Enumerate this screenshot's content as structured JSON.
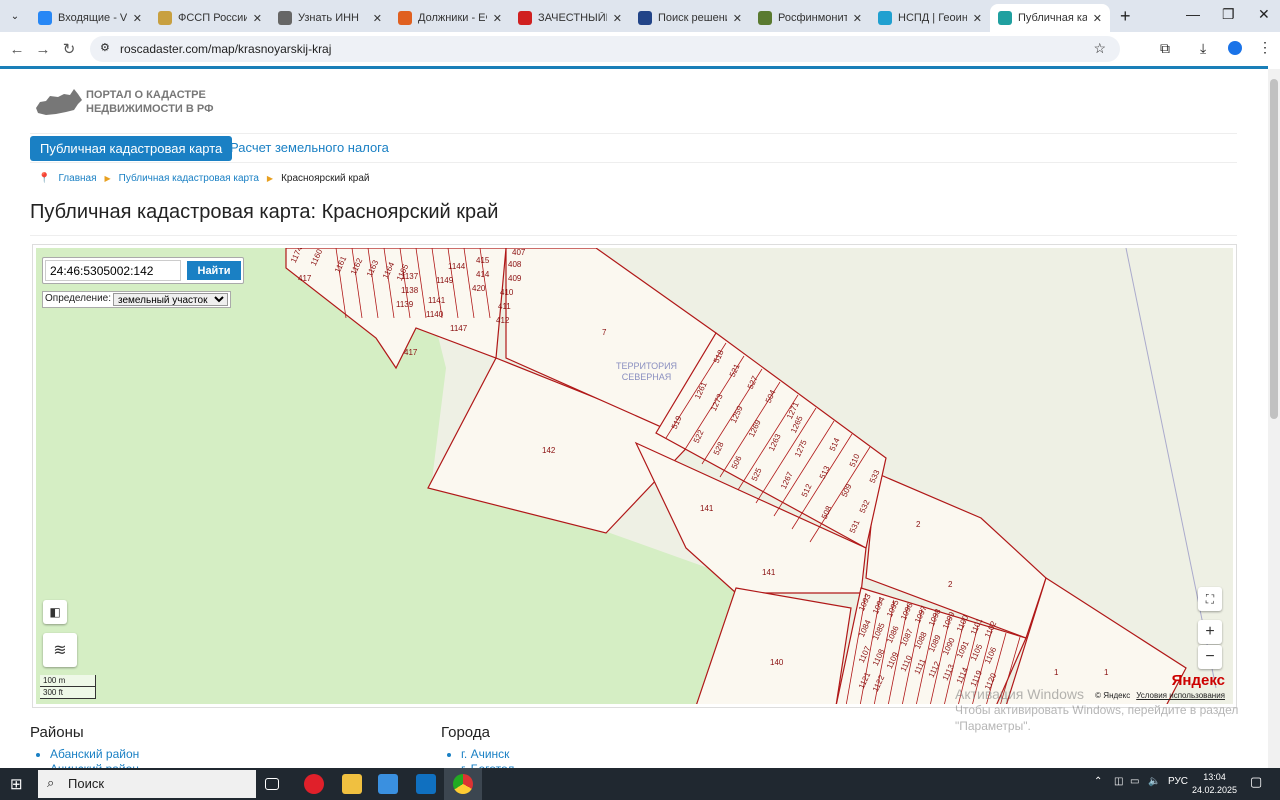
{
  "browser": {
    "tabs": [
      {
        "title": "Входящие - VK",
        "color": "#2787f5"
      },
      {
        "title": "ФССП России |",
        "color": "#c8a040"
      },
      {
        "title": "Узнать ИНН",
        "color": "#666"
      },
      {
        "title": "Должники - ЕФ",
        "color": "#e06020"
      },
      {
        "title": "ЗАЧЕСТНЫЙБИ",
        "color": "#d02020"
      },
      {
        "title": "Поиск решений",
        "color": "#224488"
      },
      {
        "title": "Росфинмонитор",
        "color": "#5a7a30"
      },
      {
        "title": "НСПД | Геоинф",
        "color": "#20a0d0"
      },
      {
        "title": "Публичная кад",
        "color": "#20a0a0"
      }
    ],
    "url": "roscadaster.com/map/krasnoyarskij-kraj"
  },
  "site": {
    "logo_line1": "ПОРТАЛ О КАДАСТРЕ",
    "logo_line2": "НЕДВИЖИМОСТИ В РФ",
    "nav_active": "Публичная кадастровая карта",
    "nav_link": "Расчет земельного налога",
    "breadcrumbs": [
      "Главная",
      "Публичная кадастровая карта",
      "Красноярский край"
    ],
    "title": "Публичная кадастровая карта: Красноярский край"
  },
  "map": {
    "search_value": "24:46:5305002:142",
    "search_button": "Найти",
    "definition_label": "Определение:",
    "definition_value": "земельный участок",
    "territory_line1": "ТЕРРИТОРИЯ",
    "territory_line2": "СЕВЕРНАЯ",
    "scale_m": "100 m",
    "scale_ft": "300 ft",
    "brand": "Яндекс",
    "copyright": "© Яндекс",
    "terms": "Условия использования",
    "zoom_in": "+",
    "zoom_out": "−",
    "parcels": [
      "1174",
      "1160",
      "1161",
      "1162",
      "1163",
      "1164",
      "1165",
      "417",
      "1137",
      "1138",
      "1139",
      "1140",
      "1141",
      "1147",
      "1149",
      "1144",
      "414",
      "415",
      "420",
      "408",
      "409",
      "410",
      "411",
      "412",
      "407",
      "417",
      "7",
      "142",
      "518",
      "521",
      "527",
      "504",
      "1271",
      "1261",
      "1273",
      "1259",
      "1269",
      "1263",
      "1265",
      "519",
      "522",
      "528",
      "506",
      "525",
      "1275",
      "514",
      "510",
      "533",
      "1267",
      "512",
      "513",
      "509",
      "532",
      "508",
      "531",
      "141",
      "141",
      "2",
      "2",
      "140",
      "1",
      "1",
      "1093",
      "1094",
      "1095",
      "1096",
      "1097",
      "1098",
      "1099",
      "1100",
      "1101",
      "1102",
      "1084",
      "1085",
      "1086",
      "1087",
      "1088",
      "1089",
      "1090",
      "1091",
      "1105",
      "1106",
      "1107",
      "1108",
      "1109",
      "1110",
      "1111",
      "1112",
      "1113",
      "1114",
      "1119",
      "1120",
      "1121",
      "1122"
    ]
  },
  "lists": {
    "districts_title": "Районы",
    "districts": [
      "Абанский район",
      "Ачинский район"
    ],
    "cities_title": "Города",
    "cities": [
      "г. Ачинск",
      "г. Боготол"
    ]
  },
  "windows": {
    "activate_title": "Активация Windows",
    "activate_text1": "Чтобы активировать Windows, перейдите в раздел",
    "activate_text2": "\"Параметры\".",
    "search": "Поиск",
    "lang": "РУС",
    "time": "13:04",
    "date": "24.02.2025"
  }
}
